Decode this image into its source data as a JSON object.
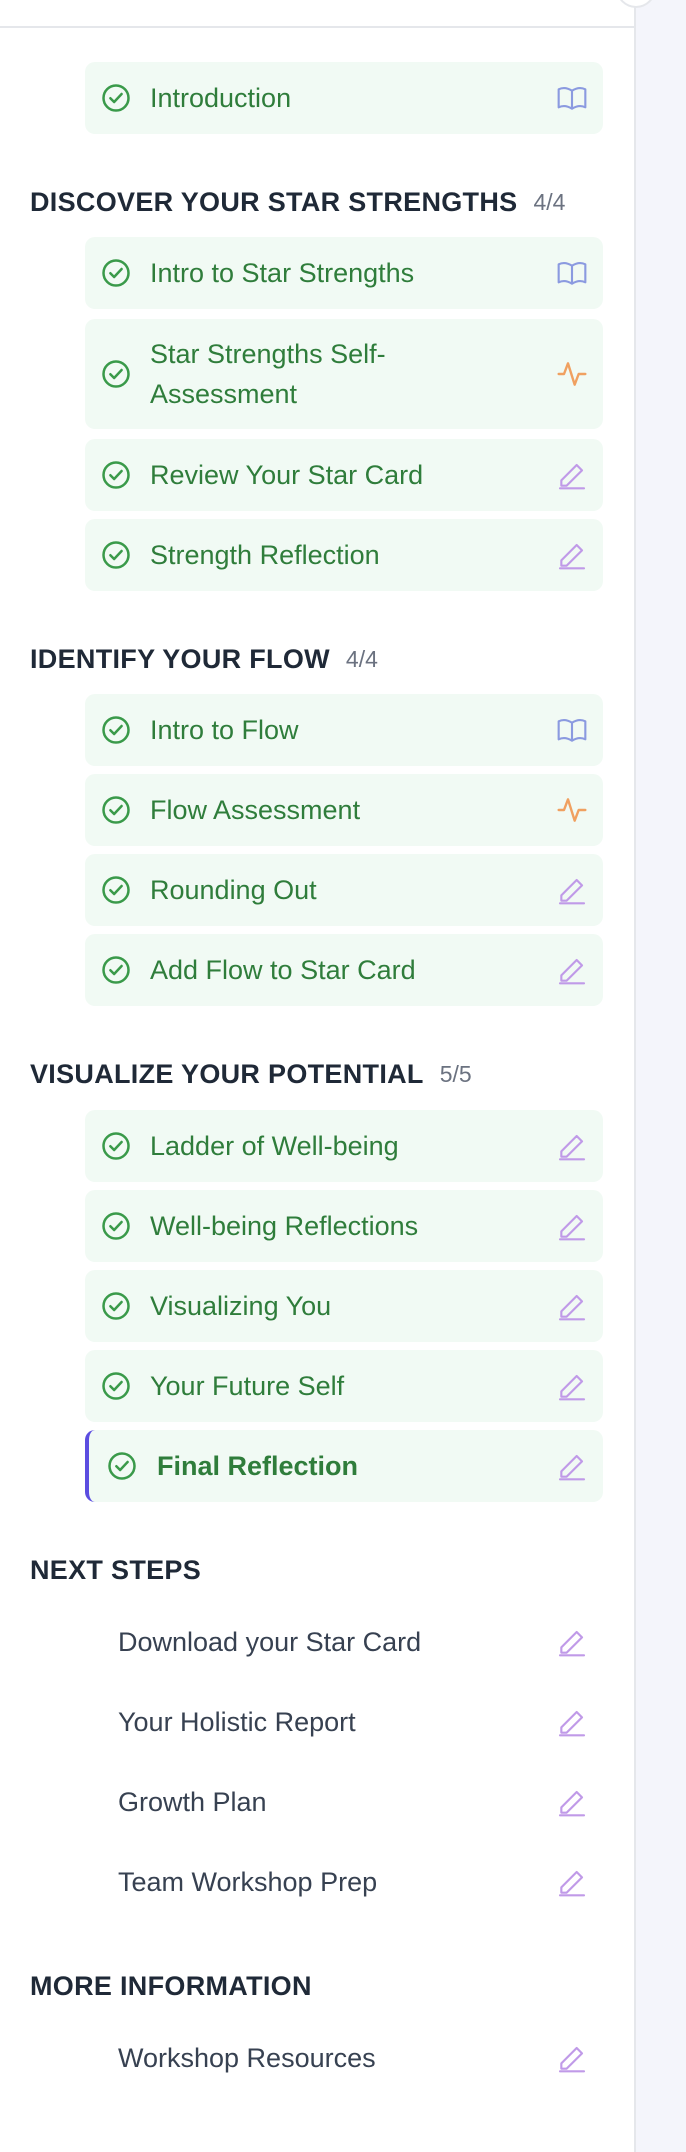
{
  "colors": {
    "complete_green": "#2f7d3b",
    "complete_bg": "#f1faf4",
    "reading_icon": "#8b9ae0",
    "assessment_icon": "#f0a060",
    "activity_icon": "#c09ae8",
    "active_accent": "#5b4de0"
  },
  "intro": {
    "items": [
      {
        "label": "Introduction",
        "status": "complete",
        "icon": "book-icon"
      }
    ]
  },
  "sections": [
    {
      "title": "DISCOVER YOUR STAR STRENGTHS",
      "count": "4/4",
      "items": [
        {
          "label": "Intro to Star Strengths",
          "status": "complete",
          "icon": "book-icon"
        },
        {
          "label": "Star Strengths Self-Assessment",
          "status": "complete",
          "icon": "activity-pulse-icon"
        },
        {
          "label": "Review Your Star Card",
          "status": "complete",
          "icon": "pencil-icon"
        },
        {
          "label": "Strength Reflection",
          "status": "complete",
          "icon": "pencil-icon"
        }
      ]
    },
    {
      "title": "IDENTIFY YOUR FLOW",
      "count": "4/4",
      "items": [
        {
          "label": "Intro to Flow",
          "status": "complete",
          "icon": "book-icon"
        },
        {
          "label": "Flow Assessment",
          "status": "complete",
          "icon": "activity-pulse-icon"
        },
        {
          "label": "Rounding Out",
          "status": "complete",
          "icon": "pencil-icon"
        },
        {
          "label": "Add Flow to Star Card",
          "status": "complete",
          "icon": "pencil-icon"
        }
      ]
    },
    {
      "title": "VISUALIZE YOUR POTENTIAL",
      "count": "5/5",
      "items": [
        {
          "label": "Ladder of Well-being",
          "status": "complete",
          "icon": "pencil-icon"
        },
        {
          "label": "Well-being Reflections",
          "status": "complete",
          "icon": "pencil-icon"
        },
        {
          "label": "Visualizing You",
          "status": "complete",
          "icon": "pencil-icon"
        },
        {
          "label": "Your Future Self",
          "status": "complete",
          "icon": "pencil-icon"
        },
        {
          "label": "Final Reflection",
          "status": "current",
          "icon": "pencil-icon"
        }
      ]
    },
    {
      "title": "NEXT STEPS",
      "count": "",
      "items": [
        {
          "label": "Download your Star Card",
          "status": "none",
          "icon": "pencil-icon"
        },
        {
          "label": "Your Holistic Report",
          "status": "none",
          "icon": "pencil-icon"
        },
        {
          "label": "Growth Plan",
          "status": "none",
          "icon": "pencil-icon"
        },
        {
          "label": "Team Workshop Prep",
          "status": "none",
          "icon": "pencil-icon"
        }
      ]
    },
    {
      "title": "MORE INFORMATION",
      "count": "",
      "items": [
        {
          "label": "Workshop Resources",
          "status": "none",
          "icon": "pencil-icon"
        }
      ]
    }
  ]
}
